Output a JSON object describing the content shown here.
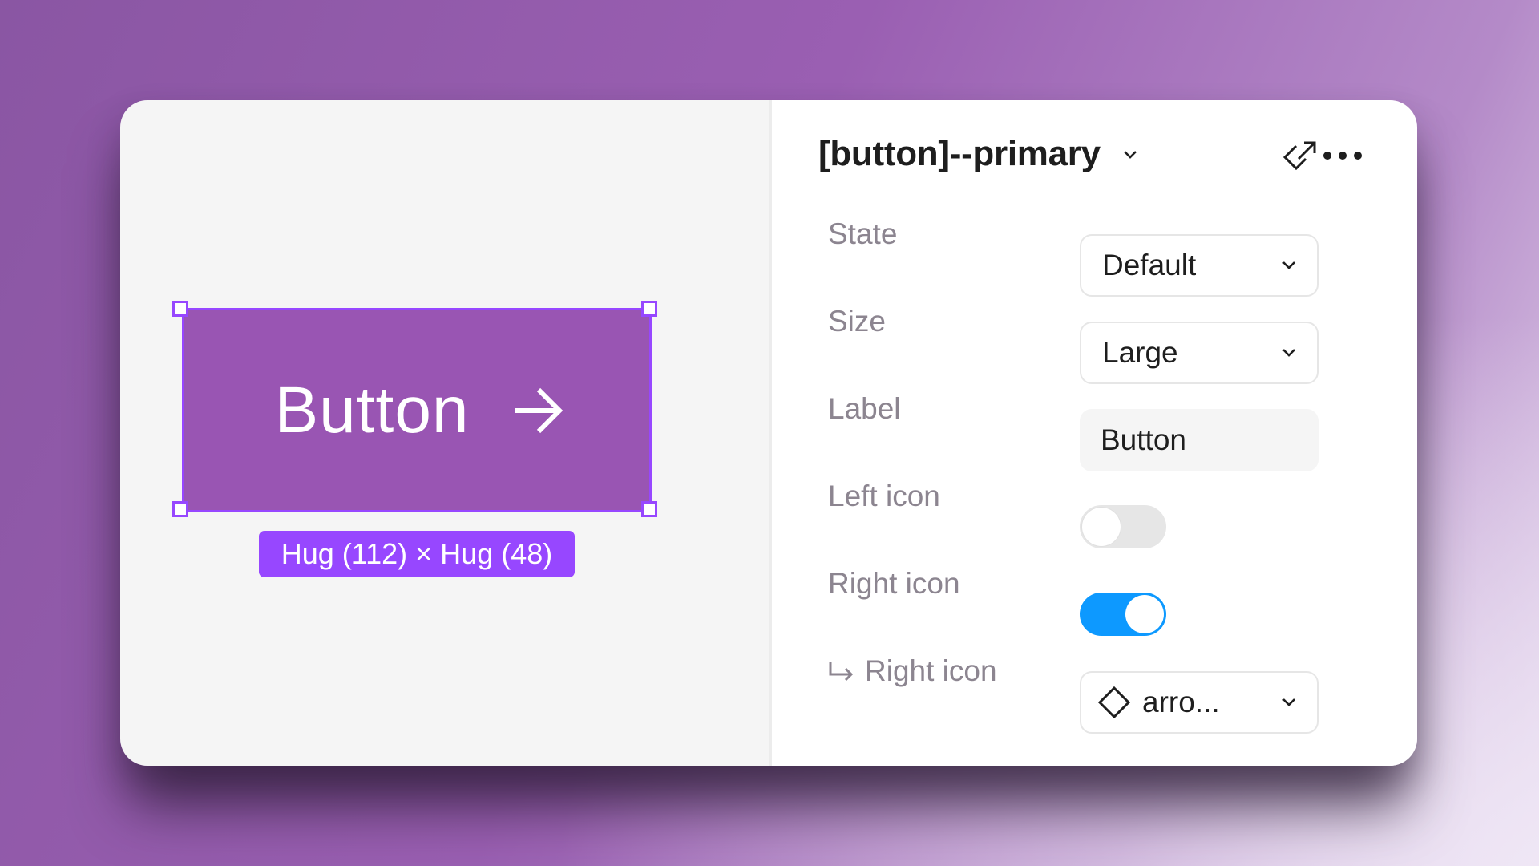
{
  "canvas": {
    "button_label": "Button",
    "button_icon": "arrow-right-icon",
    "size_badge": "Hug (112) × Hug (48)",
    "colors": {
      "button_fill": "#9955b3",
      "selection": "#9747ff",
      "canvas_bg": "#f5f5f5"
    }
  },
  "panel": {
    "title": "[button]--primary",
    "header_icons": [
      "chevron-down-icon",
      "go-to-main-component-icon",
      "more-options-icon"
    ],
    "properties": [
      {
        "label": "State",
        "type": "dropdown",
        "value": "Default"
      },
      {
        "label": "Size",
        "type": "dropdown",
        "value": "Large"
      },
      {
        "label": "Label",
        "type": "text",
        "value": "Button"
      },
      {
        "label": "Left icon",
        "type": "toggle",
        "value": false
      },
      {
        "label": "Right icon",
        "type": "toggle",
        "value": true
      },
      {
        "label": "Right icon",
        "type": "instance-swap",
        "value": "arro...",
        "nested": true,
        "icon": "component-instance-icon"
      }
    ],
    "colors": {
      "toggle_on": "#0d99ff",
      "toggle_off": "#e6e6e6",
      "label_text": "#8c8590",
      "value_text": "#1e1e1e"
    }
  }
}
